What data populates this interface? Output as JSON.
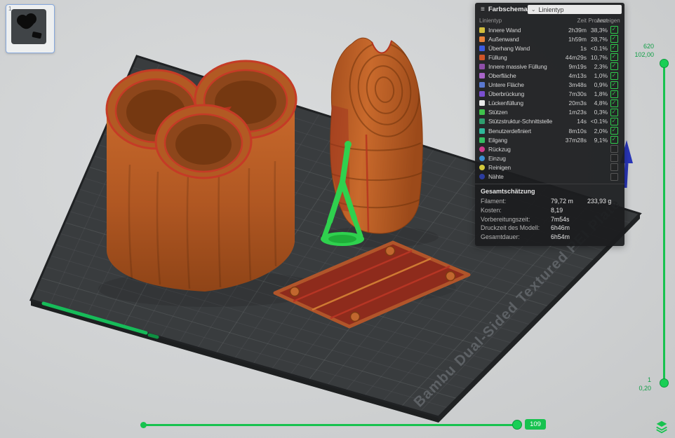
{
  "thumbnail": {
    "index": "1"
  },
  "panel": {
    "menu_icon": "≡",
    "title": "Farbschema",
    "dropdown": {
      "caret": "⌄",
      "value": "Linientyp"
    },
    "table": {
      "headers": {
        "type": "Linientyp",
        "time": "Zeit",
        "percent": "Prozent",
        "show": "Anzeigen"
      },
      "rows": [
        {
          "label": "Innere Wand",
          "color": "#d2be3e",
          "time": "2h39m",
          "percent": "38,3%",
          "checked": true
        },
        {
          "label": "Außenwand",
          "color": "#e8813a",
          "time": "1h59m",
          "percent": "28,7%",
          "checked": true
        },
        {
          "label": "Überhang Wand",
          "color": "#3d5be0",
          "time": "1s",
          "percent": "<0.1%",
          "checked": true
        },
        {
          "label": "Füllung",
          "color": "#ce5428",
          "time": "44m29s",
          "percent": "10,7%",
          "checked": true
        },
        {
          "label": "Innere massive Füllung",
          "color": "#8f4fa8",
          "time": "9m19s",
          "percent": "2,3%",
          "checked": true
        },
        {
          "label": "Oberfläche",
          "color": "#a865c8",
          "time": "4m13s",
          "percent": "1,0%",
          "checked": true
        },
        {
          "label": "Untere Fläche",
          "color": "#5a78d0",
          "time": "3m48s",
          "percent": "0,9%",
          "checked": true
        },
        {
          "label": "Überbrückung",
          "color": "#7a4fd0",
          "time": "7m30s",
          "percent": "1,8%",
          "checked": true
        },
        {
          "label": "Lückenfüllung",
          "color": "#e8e8e8",
          "time": "20m3s",
          "percent": "4,8%",
          "checked": true
        },
        {
          "label": "Stützen",
          "color": "#3fc24c",
          "time": "1m23s",
          "percent": "0,3%",
          "checked": true
        },
        {
          "label": "Stützstruktur-Schnittstelle",
          "color": "#2f9e6e",
          "time": "14s",
          "percent": "<0.1%",
          "checked": true
        },
        {
          "label": "Benutzerdefiniert",
          "color": "#30b89a",
          "time": "8m10s",
          "percent": "2,0%",
          "checked": true
        },
        {
          "label": "Eilgang",
          "color": "#35be62",
          "time": "37m28s",
          "percent": "9,1%",
          "checked": true
        },
        {
          "label": "Rückzug",
          "color": "#cf3c8e",
          "dot": true,
          "time": "",
          "percent": "",
          "checked": false
        },
        {
          "label": "Einzug",
          "color": "#3d8ed2",
          "dot": true,
          "time": "",
          "percent": "",
          "checked": false
        },
        {
          "label": "Reinigen",
          "color": "#d2c83c",
          "dot": true,
          "time": "",
          "percent": "",
          "checked": false
        },
        {
          "label": "Nähte",
          "color": "#2b3c9e",
          "dot": true,
          "time": "",
          "percent": "",
          "checked": false
        }
      ]
    },
    "summary": {
      "title": "Gesamtschätzung",
      "rows": [
        {
          "label": "Filament:",
          "value": "79,72 m",
          "value2": "233,93 g"
        },
        {
          "label": "Kosten:",
          "value": "8,19",
          "value2": ""
        },
        {
          "label": "Vorbereitungszeit:",
          "value": "7m54s",
          "value2": ""
        },
        {
          "label": "Druckzeit des Modell:",
          "value": "6h46m",
          "value2": ""
        },
        {
          "label": "Gesamtdauer:",
          "value": "6h54m",
          "value2": ""
        }
      ]
    }
  },
  "plate": {
    "label": "Bambu Dual-Sided Textured PEI Plate"
  },
  "layer_slider": {
    "top_layer": "620",
    "top_height": "102,00",
    "bottom_layer": "1",
    "bottom_height": "0,20"
  },
  "move_slider": {
    "value": "109"
  },
  "colors": {
    "accent_green": "#17c24f",
    "plate": "#393c3e"
  }
}
